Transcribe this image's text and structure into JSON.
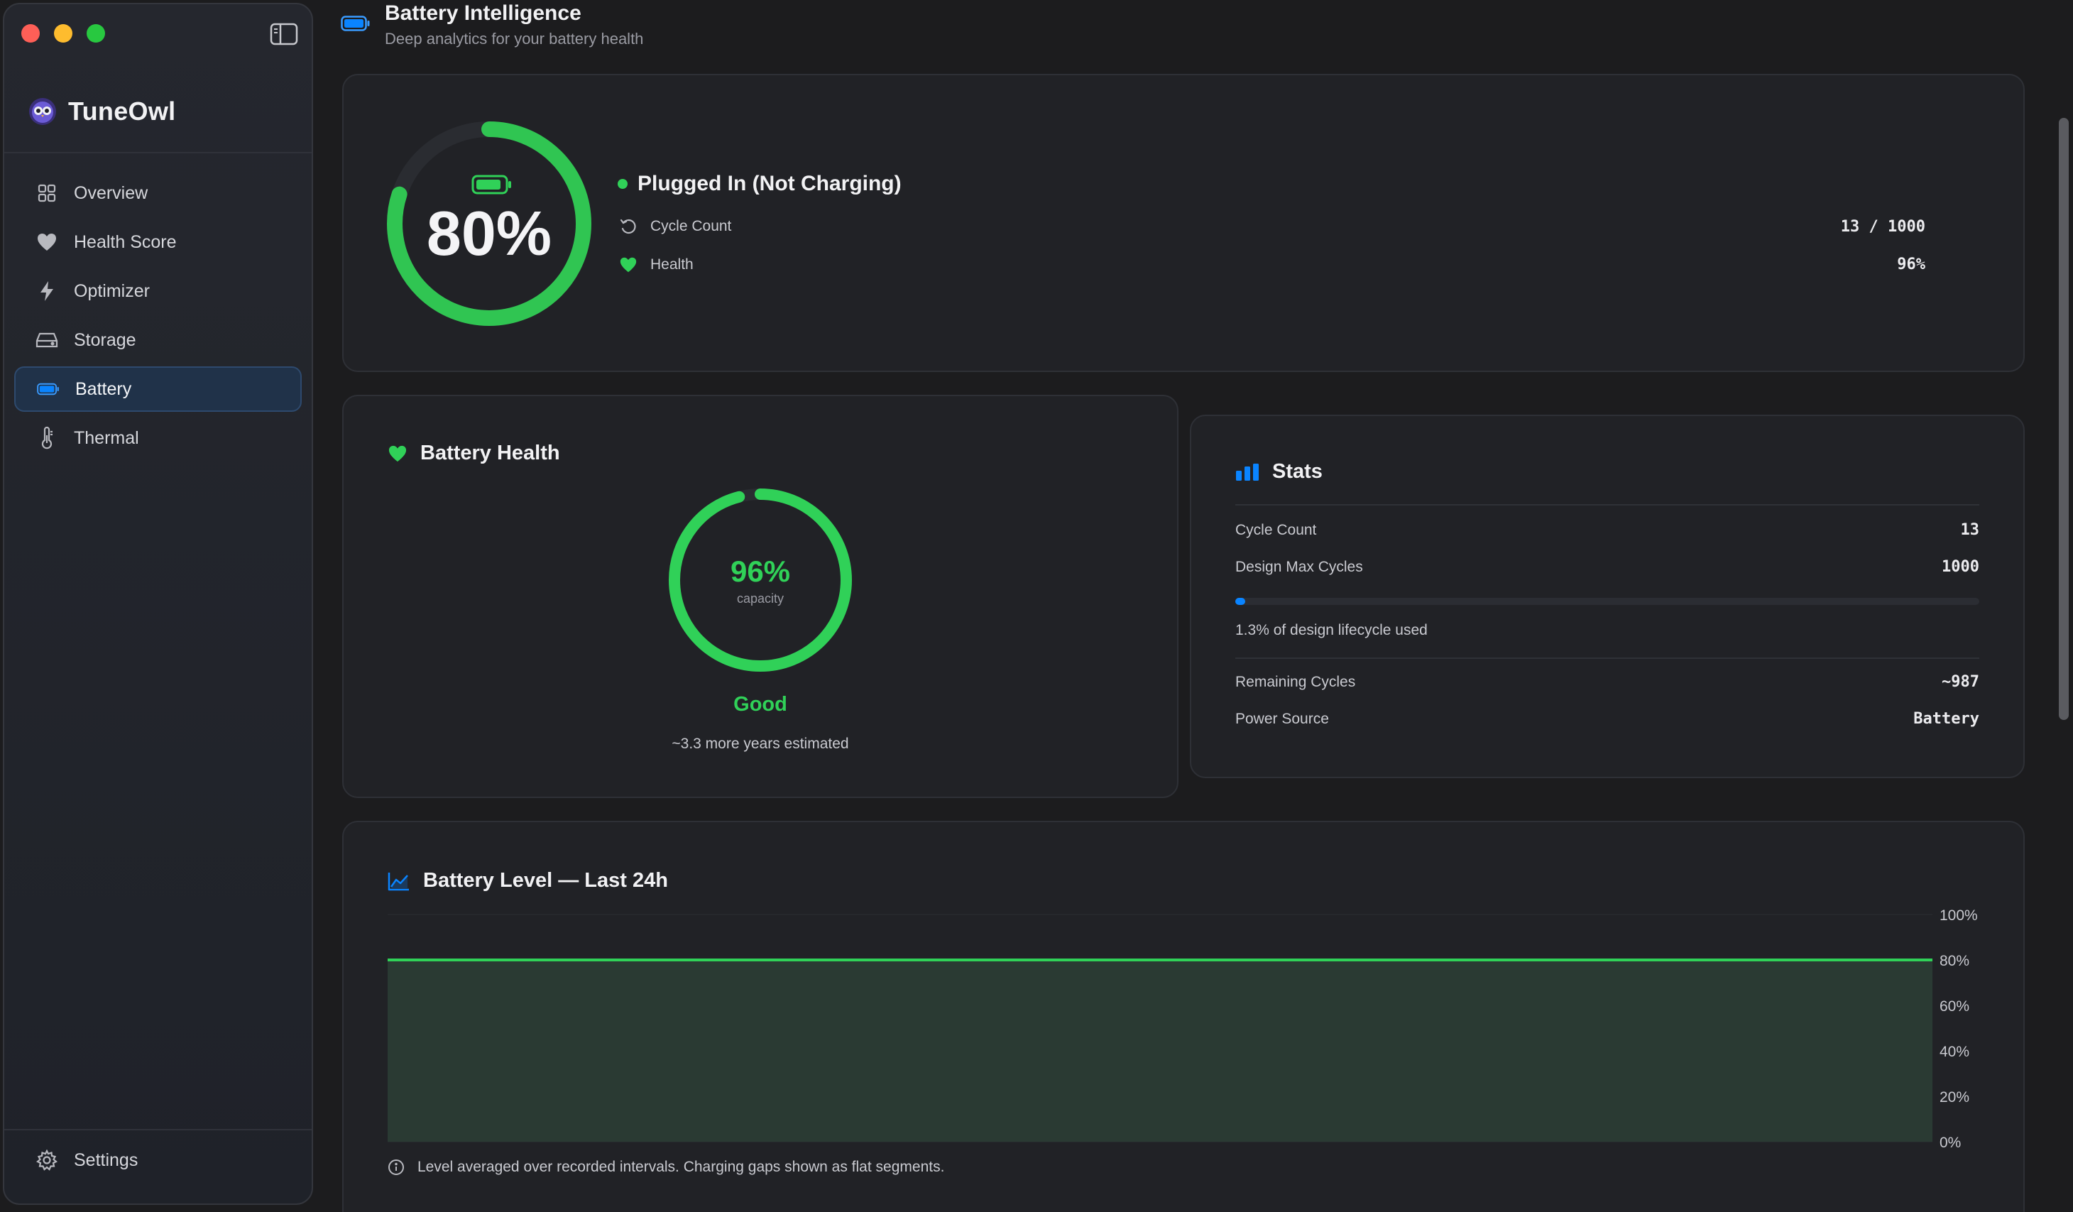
{
  "window": {
    "controls": [
      "close",
      "minimize",
      "zoom"
    ]
  },
  "sidebar": {
    "brand": "TuneOwl",
    "items": [
      {
        "label": "Overview",
        "icon": "grid-icon",
        "active": false
      },
      {
        "label": "Health Score",
        "icon": "heart-icon",
        "active": false
      },
      {
        "label": "Optimizer",
        "icon": "bolt-icon",
        "active": false
      },
      {
        "label": "Storage",
        "icon": "drive-icon",
        "active": false
      },
      {
        "label": "Battery",
        "icon": "battery-icon",
        "active": true
      },
      {
        "label": "Thermal",
        "icon": "thermometer-icon",
        "active": false
      }
    ],
    "settings_label": "Settings"
  },
  "header": {
    "title": "Battery Intelligence",
    "subtitle": "Deep analytics for your battery health"
  },
  "overview": {
    "percent": "80%",
    "percent_value": 80,
    "status": "Plugged In (Not Charging)",
    "cycle_label": "Cycle Count",
    "cycle_value": "13 / 1000",
    "health_label": "Health",
    "health_value": "96%"
  },
  "battery_health": {
    "title": "Battery Health",
    "percent": "96%",
    "percent_value": 96,
    "caption": "capacity",
    "grade": "Good",
    "estimate": "~3.3 more years estimated"
  },
  "stats": {
    "title": "Stats",
    "cycle_count_label": "Cycle Count",
    "cycle_count_value": "13",
    "design_max_label": "Design Max Cycles",
    "design_max_value": "1000",
    "lifecycle_used_fraction": 0.013,
    "lifecycle_note": "1.3% of design lifecycle used",
    "remaining_label": "Remaining Cycles",
    "remaining_value": "~987",
    "power_source_label": "Power Source",
    "power_source_value": "Battery"
  },
  "chart": {
    "title": "Battery Level — Last 24h",
    "footnote": "Level averaged over recorded intervals. Charging gaps shown as flat segments."
  },
  "chart_data": {
    "type": "area",
    "title": "Battery Level — Last 24h",
    "ylim": [
      0,
      100
    ],
    "yticks": [
      "100%",
      "80%",
      "60%",
      "40%",
      "20%",
      "0%"
    ],
    "ytick_values": [
      100,
      80,
      60,
      40,
      20,
      0
    ],
    "series": [
      {
        "values": [
          80,
          80
        ]
      }
    ],
    "line_color": "#30d158",
    "fill_color": "#2a3a33",
    "grid": true
  },
  "colors": {
    "accent_green": "#30d158",
    "accent_blue": "#0a84ff",
    "active_nav_bg": "#203249"
  }
}
